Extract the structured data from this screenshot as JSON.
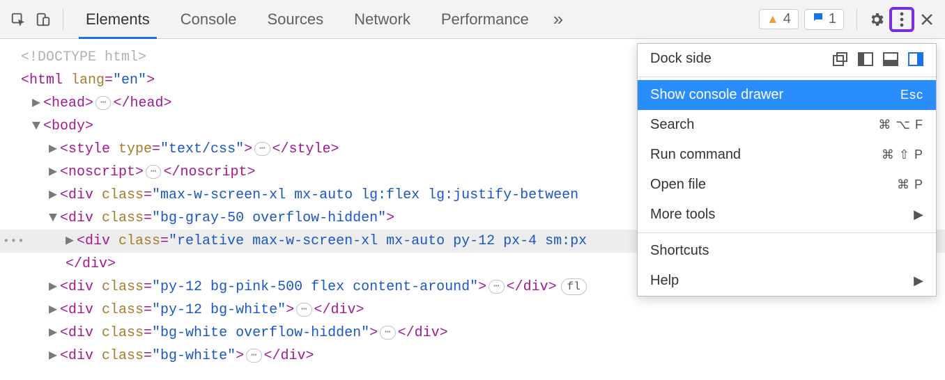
{
  "toolbar": {
    "tabs": [
      "Elements",
      "Console",
      "Sources",
      "Network",
      "Performance"
    ],
    "active_tab_index": 0,
    "warnings_count": "4",
    "messages_count": "1"
  },
  "menu": {
    "dock_label": "Dock side",
    "items": {
      "console": {
        "label": "Show console drawer",
        "shortcut": "Esc"
      },
      "search": {
        "label": "Search",
        "shortcut": "⌘ ⌥ F"
      },
      "runcmd": {
        "label": "Run command",
        "shortcut": "⌘ ⇧ P"
      },
      "open": {
        "label": "Open file",
        "shortcut": "⌘ P"
      },
      "more": {
        "label": "More tools"
      },
      "shortcuts": {
        "label": "Shortcuts"
      },
      "help": {
        "label": "Help"
      }
    }
  },
  "code": {
    "doctype": "<!DOCTYPE html>",
    "html_open": "<html lang=\"en\">",
    "head_open": "<head>",
    "head_close": "</head>",
    "body_open": "<body>",
    "style_open": "<style type=\"text/css\">",
    "style_close": "</style>",
    "noscript_open": "<noscript>",
    "noscript_close": "</noscript>",
    "div1_open": "<div class=\"max-w-screen-xl mx-auto lg:flex lg:justify-between",
    "div2_open": "<div class=\"bg-gray-50 overflow-hidden\">",
    "div3_open": "<div class=\"relative max-w-screen-xl mx-auto py-12 px-4 sm:px",
    "div_close": "</div>",
    "div4_open": "<div class=\"py-12 bg-pink-500 flex content-around\">",
    "div4_pill": "fl",
    "div5_open": "<div class=\"py-12 bg-white\">",
    "div6_open": "<div class=\"bg-white overflow-hidden\">",
    "div7_open": "<div class=\"bg-white\">"
  }
}
